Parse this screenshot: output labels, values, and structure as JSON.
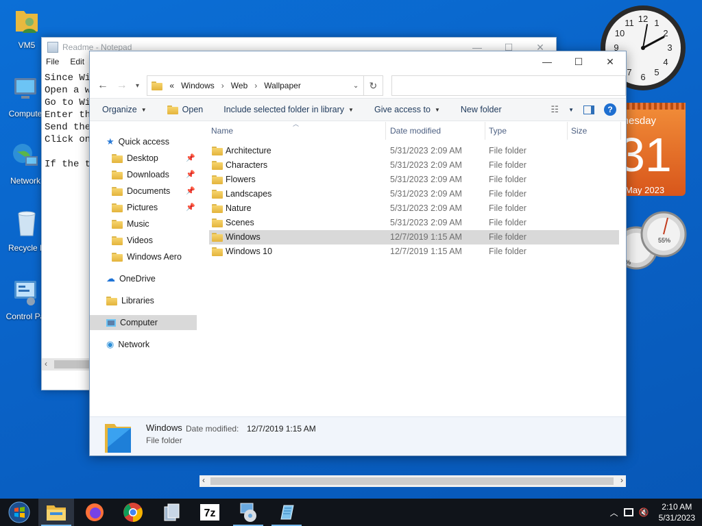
{
  "desktop": {
    "icons": [
      {
        "label": "VM5"
      },
      {
        "label": "Compute"
      },
      {
        "label": "Network"
      },
      {
        "label": "Recycle B"
      },
      {
        "label": "Control Pa"
      }
    ]
  },
  "gadgets": {
    "calendar": {
      "weekday": "ednesday",
      "day": "31",
      "month": "May 2023"
    },
    "meter": {
      "value": "55%",
      "value2": "%"
    }
  },
  "notepad": {
    "title": "Readme - Notepad",
    "menu": [
      "File",
      "Edit"
    ],
    "lines": [
      "Since Wi",
      "Open a w",
      "Go to Wi",
      "Enter th",
      "Send the",
      "Click on",
      "",
      "If the t"
    ]
  },
  "explorer": {
    "breadcrumb": {
      "prefix": "«",
      "parts": [
        "Windows",
        "Web",
        "Wallpaper"
      ]
    },
    "search_placeholder": "",
    "toolbar": {
      "organize": "Organize",
      "open": "Open",
      "include": "Include selected folder in library",
      "share": "Give access to",
      "new_folder": "New folder"
    },
    "nav": {
      "quick_access": "Quick access",
      "pinned": [
        "Desktop",
        "Downloads",
        "Documents",
        "Pictures"
      ],
      "folders": [
        "Music",
        "Videos",
        "Windows Aero"
      ],
      "onedrive": "OneDrive",
      "libraries": "Libraries",
      "computer": "Computer",
      "network": "Network"
    },
    "columns": {
      "name": "Name",
      "date": "Date modified",
      "type": "Type",
      "size": "Size"
    },
    "rows": [
      {
        "name": "Architecture",
        "date": "5/31/2023 2:09 AM",
        "type": "File folder"
      },
      {
        "name": "Characters",
        "date": "5/31/2023 2:09 AM",
        "type": "File folder"
      },
      {
        "name": "Flowers",
        "date": "5/31/2023 2:09 AM",
        "type": "File folder"
      },
      {
        "name": "Landscapes",
        "date": "5/31/2023 2:09 AM",
        "type": "File folder"
      },
      {
        "name": "Nature",
        "date": "5/31/2023 2:09 AM",
        "type": "File folder"
      },
      {
        "name": "Scenes",
        "date": "5/31/2023 2:09 AM",
        "type": "File folder"
      },
      {
        "name": "Windows",
        "date": "12/7/2019 1:15 AM",
        "type": "File folder",
        "selected": true
      },
      {
        "name": "Windows 10",
        "date": "12/7/2019 1:15 AM",
        "type": "File folder"
      }
    ],
    "details": {
      "name": "Windows",
      "date_label": "Date modified:",
      "date_value": "12/7/2019 1:15 AM",
      "type": "File folder"
    }
  },
  "taskbar": {
    "apps": [
      "file-explorer",
      "firefox",
      "chrome",
      "archive-tool",
      "7-zip",
      "disc-utility",
      "notepad"
    ],
    "time": "2:10 AM",
    "date": "5/31/2023"
  }
}
